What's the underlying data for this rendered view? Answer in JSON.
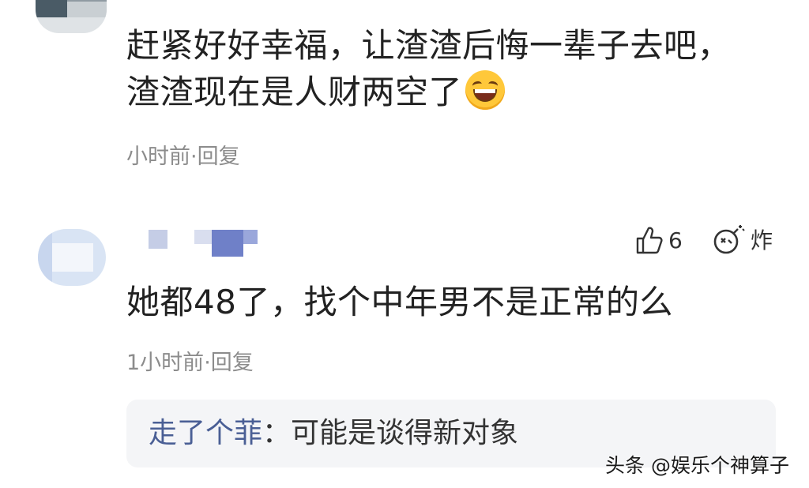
{
  "comment1": {
    "text_line1": "赶紧好好幸福，让渣渣后悔一辈子去吧，",
    "text_line2": "渣渣现在是人财两空了",
    "emoji": "laughing-emoji",
    "time": "小时前",
    "reply_label": "回复"
  },
  "comment2": {
    "likes": "6",
    "bomb_label": "炸",
    "text": "她都48了，找个中年男不是正常的么",
    "time": "1小时前",
    "reply_label": "回复",
    "nested_reply": {
      "author": "走了个菲",
      "separator": "：",
      "text": "可能是谈得新对象"
    }
  },
  "watermark": "头条 @娱乐个神算子",
  "colors": {
    "reply_author": "#4a5f95",
    "meta_text": "#8c8c8c",
    "reply_bg": "#f4f5f7"
  }
}
